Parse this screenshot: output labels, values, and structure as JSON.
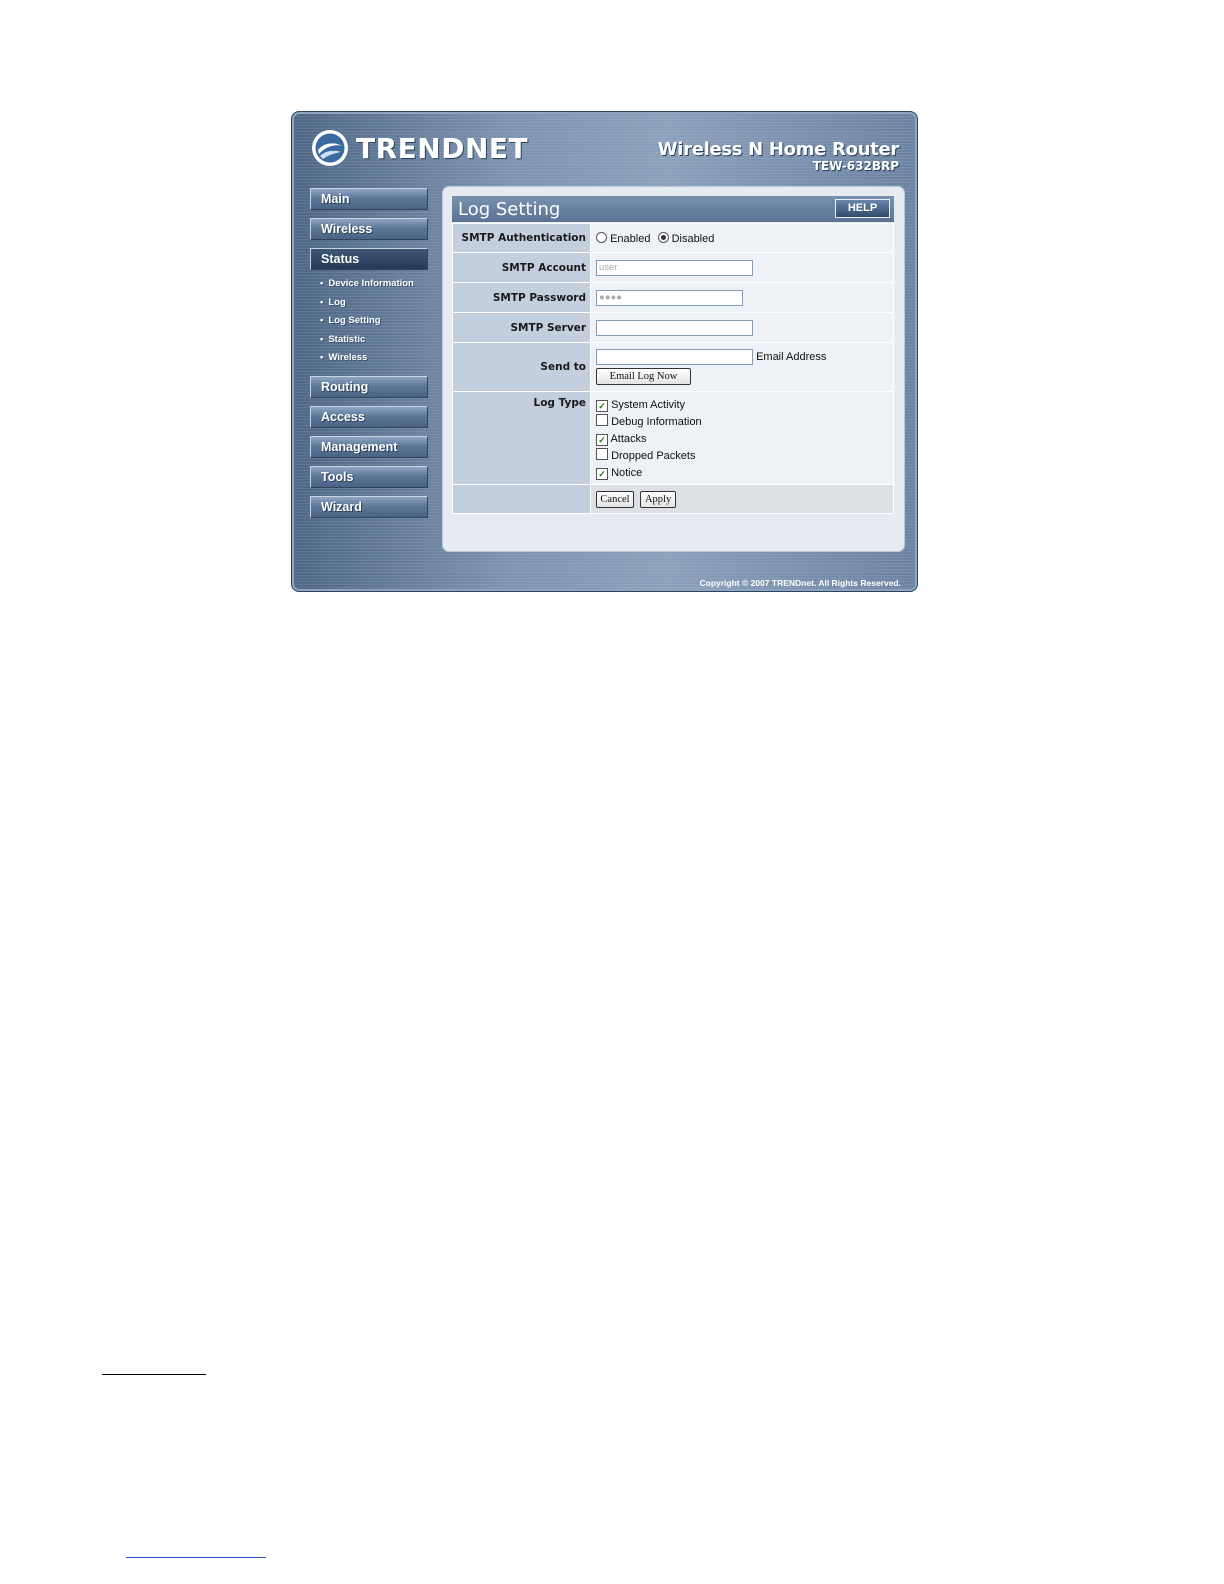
{
  "header": {
    "brand": "TRENDNET",
    "product_title": "Wireless N Home Router",
    "model": "TEW-632BRP"
  },
  "nav": {
    "items": [
      {
        "label": "Main"
      },
      {
        "label": "Wireless"
      },
      {
        "label": "Status",
        "active": true
      },
      {
        "label": "Routing"
      },
      {
        "label": "Access"
      },
      {
        "label": "Management"
      },
      {
        "label": "Tools"
      },
      {
        "label": "Wizard"
      }
    ],
    "status_subitems": [
      {
        "label": "Device Information"
      },
      {
        "label": "Log"
      },
      {
        "label": "Log Setting"
      },
      {
        "label": "Statistic"
      },
      {
        "label": "Wireless"
      }
    ]
  },
  "panel": {
    "title": "Log Setting",
    "help_label": "HELP"
  },
  "form": {
    "smtp_auth": {
      "label": "SMTP Authentication",
      "options": [
        {
          "label": "Enabled",
          "selected": false
        },
        {
          "label": "Disabled",
          "selected": true
        }
      ]
    },
    "smtp_account": {
      "label": "SMTP Account",
      "value": "user"
    },
    "smtp_password": {
      "label": "SMTP Password",
      "value": "●●●●"
    },
    "smtp_server": {
      "label": "SMTP Server",
      "value": ""
    },
    "send_to": {
      "label": "Send to",
      "value": "",
      "suffix": "Email Address",
      "email_now_label": "Email Log Now"
    },
    "log_type": {
      "label": "Log Type",
      "options": [
        {
          "label": "System Activity",
          "checked": true
        },
        {
          "label": "Debug Information",
          "checked": false
        },
        {
          "label": "Attacks",
          "checked": true
        },
        {
          "label": "Dropped Packets",
          "checked": false
        },
        {
          "label": "Notice",
          "checked": true
        }
      ]
    },
    "cancel_label": "Cancel",
    "apply_label": "Apply"
  },
  "footer": {
    "copyright": "Copyright © 2007 TRENDnet. All Rights Reserved."
  }
}
